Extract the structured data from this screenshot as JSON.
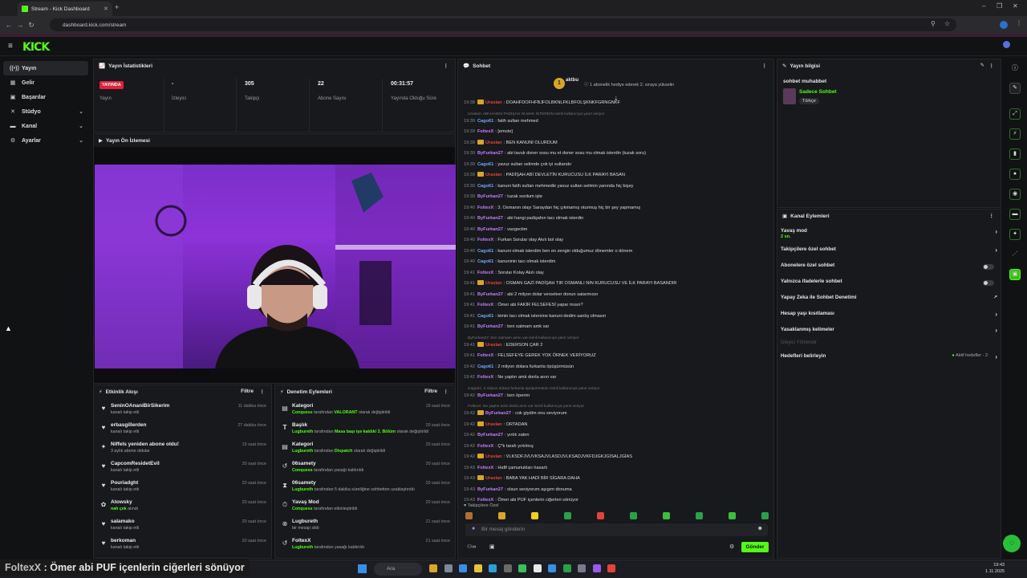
{
  "browser": {
    "tab_title": "Stream - Kick Dashboard",
    "url": "dashboard.kick.com/stream"
  },
  "logo": "KICK",
  "sidebar": {
    "items": [
      {
        "label": "Yayın",
        "icon": "broadcast-icon"
      },
      {
        "label": "Gelir",
        "icon": "money-icon"
      },
      {
        "label": "Başarılar",
        "icon": "trophy-icon"
      },
      {
        "label": "Stüdyo",
        "icon": "studio-icon"
      },
      {
        "label": "Kanal",
        "icon": "channel-icon"
      },
      {
        "label": "Ayarlar",
        "icon": "gear-icon"
      }
    ]
  },
  "stats": {
    "title": "Yayın İstatistikleri",
    "items": [
      {
        "value": "YAYINDA",
        "label": "Yayın"
      },
      {
        "value": "-",
        "label": "İzleyici"
      },
      {
        "value": "305",
        "label": "Takipçi"
      },
      {
        "value": "22",
        "label": "Abone Sayısı"
      },
      {
        "value": "00:31:57",
        "label": "Yayında Olduğu Süre"
      }
    ]
  },
  "preview": {
    "title": "Yayın Ön İzlemesi"
  },
  "activity": {
    "title": "Etkinlik Akışı",
    "filter": "Filtre",
    "items": [
      {
        "icon": "heart-icon",
        "name": "SeninOAnaniBirSikerim",
        "sub": "kanalı takip etti",
        "time": "11 dakika önce"
      },
      {
        "icon": "heart-icon",
        "name": "erbasgillerden",
        "sub": "kanalı takip etti",
        "time": "27 dakika önce"
      },
      {
        "icon": "sparkle-icon",
        "name": "Niffels yeniden abone oldu!",
        "sub": "3 aylık abone oldular",
        "time": "19 saat önce"
      },
      {
        "icon": "heart-icon",
        "name": "CapcomResidetEvil",
        "sub": "kanalı takip etti",
        "time": "20 saat önce"
      },
      {
        "icon": "heart-icon",
        "name": "Pouriadght",
        "sub": "kanalı takip etti",
        "time": "20 saat önce"
      },
      {
        "icon": "gift-icon",
        "name": "Atowsky",
        "sub": "nah çek",
        "sub_suffix": "alındı",
        "time": "20 saat önce"
      },
      {
        "icon": "heart-icon",
        "name": "salamako",
        "sub": "kanalı takip etti",
        "time": "20 saat önce"
      },
      {
        "icon": "heart-icon",
        "name": "berkoman",
        "sub": "kanalı takip etti",
        "time": "20 saat önce"
      }
    ]
  },
  "moderation": {
    "title": "Denetim Eylemleri",
    "filter": "Filtre",
    "items": [
      {
        "icon": "category-icon",
        "name": "Kategori",
        "who": "Conquess",
        "mid": " tarafından ",
        "val": "VALORANT",
        "tail": " olarak değiştirildi",
        "time": "19 saat önce"
      },
      {
        "icon": "title-icon",
        "name": "Başlık",
        "who": "Lugbureth",
        "mid": " tarafından ",
        "val": "Masa başı işe kaldık/ 2. Bölüm",
        "tail": " olarak değiştirildi",
        "time": "20 saat önce"
      },
      {
        "icon": "category-icon",
        "name": "Kategori",
        "who": "Lugbureth",
        "mid": " tarafından ",
        "val": "Dispatch",
        "tail": " olarak değiştirildi",
        "time": "20 saat önce"
      },
      {
        "icon": "undo-icon",
        "name": "06samety",
        "who": "Conquess",
        "mid": " tarafından yasağı kaldırıldı",
        "val": "",
        "tail": "",
        "time": "20 saat önce"
      },
      {
        "icon": "hourglass-icon",
        "name": "06samety",
        "who": "Lugbureth",
        "mid": " tarafından 5 dakika süreliğine sohbetten uzaklaştırıldı",
        "val": "",
        "tail": "",
        "time": "20 saat önce"
      },
      {
        "icon": "slow-icon",
        "name": "Yavaş Mod",
        "who": "Conquess",
        "mid": " tarafından etkinleştirildi",
        "val": "",
        "tail": "",
        "time": "20 saat önce"
      },
      {
        "icon": "delete-icon",
        "name": "Lugbureth",
        "who": "",
        "mid": "bir mesajı sildi",
        "val": "",
        "tail": "",
        "time": "21 saat önce"
      },
      {
        "icon": "undo-icon",
        "name": "FoltexX",
        "who": "Lugbureth",
        "mid": " tarafından yasağı kaldırıldı",
        "val": "",
        "tail": "",
        "time": "21 saat önce"
      }
    ]
  },
  "chat": {
    "title": "Sohbet",
    "pinned_user": "aktbu",
    "pinned_count": "1",
    "pinned_text": "1 abonelik hediye ederek 2. sıraya yükselin",
    "messages": [
      {
        "type": "msg",
        "time": "19:38",
        "user": "Uraslan",
        "color": "#e0443a",
        "tier": true,
        "text": ": DOAHFDOFHFBJFOLBKNLFKLBFOLŞKNKFGRNGNKF"
      },
      {
        "type": "reply",
        "text": "Uraslan: ABİ HANGİ PADİŞAH OLMAK İSTERDİN isimli kullanıcıya yanıt veriyor"
      },
      {
        "type": "msg",
        "time": "19:39",
        "user": "Cago61",
        "color": "#6fa8ff",
        "tier": false,
        "text": ": fatih sultan mehmed"
      },
      {
        "type": "msg",
        "time": "19:39",
        "user": "FoltexX",
        "color": "#c77dff",
        "tier": false,
        "text": ": [emote]"
      },
      {
        "type": "msg",
        "time": "19:39",
        "user": "Uraslan",
        "color": "#e0443a",
        "tier": true,
        "text": ": BEN KANUNİ OLURDUM"
      },
      {
        "type": "msg",
        "time": "19:39",
        "user": "ByFurkan27",
        "color": "#c77dff",
        "tier": false,
        "text": ": abi tavuk doner sosu mu et doner sosu mu olmak isterdin (tuzak soru)"
      },
      {
        "type": "msg",
        "time": "19:39",
        "user": "Cago61",
        "color": "#6fa8ff",
        "tier": false,
        "text": ": yavuz sultan selimde çok iyi sultandır"
      },
      {
        "type": "msg",
        "time": "19:39",
        "user": "Uraslan",
        "color": "#e0443a",
        "tier": true,
        "text": ": PADİŞAH ABİ DEVLETİN KURUCUSU İLK PARAYI BASAN"
      },
      {
        "type": "msg",
        "time": "19:39",
        "user": "Cago61",
        "color": "#6fa8ff",
        "tier": false,
        "text": ": kanuni fatih sultan mehmedle yavuz sultan selimin yanında hiç bişey"
      },
      {
        "type": "msg",
        "time": "19:39",
        "user": "ByFurkan27",
        "color": "#c77dff",
        "tier": false,
        "text": ": tuzak sordum işte"
      },
      {
        "type": "msg",
        "time": "19:40",
        "user": "FoltexX",
        "color": "#c77dff",
        "tier": false,
        "text": ": 3. Osmanın olayı Saraydan hiç çıkmamış oturmuş hiç bir şey yapmamış"
      },
      {
        "type": "msg",
        "time": "19:40",
        "user": "ByFurkan27",
        "color": "#c77dff",
        "tier": false,
        "text": ": abi hangi padişahın tacı olmak isterdin"
      },
      {
        "type": "msg",
        "time": "19:40",
        "user": "ByFurkan27",
        "color": "#c77dff",
        "tier": false,
        "text": ": vazgectim"
      },
      {
        "type": "msg",
        "time": "19:40",
        "user": "FoltexX",
        "color": "#c77dff",
        "tier": false,
        "text": ": Furkan Sorular olay Akılı bol olay"
      },
      {
        "type": "msg",
        "time": "19:40",
        "user": "Cago61",
        "color": "#6fa8ff",
        "tier": false,
        "text": ": kanuni olmak isterdim ben en zengin olduğumuz dönemler o dönem"
      },
      {
        "type": "msg",
        "time": "19:40",
        "user": "Cago61",
        "color": "#6fa8ff",
        "tier": false,
        "text": ": kanuninin tacı olmak isterdim"
      },
      {
        "type": "msg",
        "time": "19:41",
        "user": "FoltexX",
        "color": "#c77dff",
        "tier": false,
        "text": ": Sorular Kolay Akılı olay"
      },
      {
        "type": "msg",
        "time": "19:41",
        "user": "Uraslan",
        "color": "#e0443a",
        "tier": true,
        "text": ": OSMAN GAZİ PADİŞAH TIR OSMANLI NIN KURUCUSU VE İLK PARAYI BASANDIR"
      },
      {
        "type": "msg",
        "time": "19:41",
        "user": "ByFurkan27",
        "color": "#c77dff",
        "tier": false,
        "text": ": abi 2 milyon dolar verseleer donun satarmısın"
      },
      {
        "type": "msg",
        "time": "19:41",
        "user": "FoltexX",
        "color": "#c77dff",
        "tier": false,
        "text": ": Ömer abi FAKİR FELSEFESİ yapar mısın?"
      },
      {
        "type": "msg",
        "time": "19:41",
        "user": "Cago61",
        "color": "#6fa8ff",
        "tier": false,
        "text": ": kimin tacı olmak istersine kanuni dedim uanlış olmasın"
      },
      {
        "type": "msg",
        "time": "19:41",
        "user": "ByFurkan27",
        "color": "#c77dff",
        "tier": false,
        "text": ": ben satmam amk var"
      },
      {
        "type": "reply",
        "text": "ByFurkan27: ben satmam amın var isimli kullanıcıya yanıt veriyor"
      },
      {
        "type": "msg",
        "time": "19:41",
        "user": "Uraslan",
        "color": "#e0443a",
        "tier": true,
        "text": ": EDERSON ÇAR 2"
      },
      {
        "type": "msg",
        "time": "19:41",
        "user": "FoltexX",
        "color": "#c77dff",
        "tier": false,
        "text": ": FELSEFEYE GEREK YOK ÖRNEK VERİYORUZ"
      },
      {
        "type": "msg",
        "time": "19:42",
        "user": "Cago61",
        "color": "#6fa8ff",
        "tier": false,
        "text": ": 2 milyon dolara furkanla öpüşürmüsün"
      },
      {
        "type": "msg",
        "time": "19:42",
        "user": "FoltexX",
        "color": "#c77dff",
        "tier": false,
        "text": ": Ne yaptın amk donla anın var"
      },
      {
        "type": "reply",
        "text": "Cago61: 2 milyon dolara furkanla öpüşürmüsün isimli kullanıcıya yanıt veriyor"
      },
      {
        "type": "msg",
        "time": "19:42",
        "user": "ByFurkan27",
        "color": "#c77dff",
        "tier": false,
        "text": ": ben öperim"
      },
      {
        "type": "reply",
        "text": "FoltexX: Ne yaptın amk donla anın var isimli kullanıcıya yanıt veriyor"
      },
      {
        "type": "msg",
        "time": "19:42",
        "user": "ByFurkan27",
        "color": "#c77dff",
        "tier": true,
        "text": ": cok giydim onu seviyorum"
      },
      {
        "type": "msg",
        "time": "19:42",
        "user": "Uraslan",
        "color": "#e0443a",
        "tier": true,
        "text": ": ORTADAN"
      },
      {
        "type": "msg",
        "time": "19:42",
        "user": "ByFurkan27",
        "color": "#c77dff",
        "tier": false,
        "text": ": yırtık zaten"
      },
      {
        "type": "msg",
        "time": "19:42",
        "user": "FoltexX",
        "color": "#c77dff",
        "tier": false,
        "text": ": Ç*k tarafı yırtılmış"
      },
      {
        "type": "msg",
        "time": "19:42",
        "user": "Uraslan",
        "color": "#e0443a",
        "tier": true,
        "text": ": VLKSDFJVUVKSAJVLASDJVLKSADJVKFDJGKJGİSALJGİAS"
      },
      {
        "type": "msg",
        "time": "19:43",
        "user": "FoltexX",
        "color": "#c77dff",
        "tier": false,
        "text": ": Hafif çamuriukları hasarlı"
      },
      {
        "type": "msg",
        "time": "19:43",
        "user": "Uraslan",
        "color": "#e0443a",
        "tier": true,
        "text": ": BABA YAK HADİ BİR SİGARA DAHA"
      },
      {
        "type": "msg",
        "time": "19:43",
        "user": "ByFurkan27",
        "color": "#c77dff",
        "tier": false,
        "text": ": olsun seviyorum aşıgım donuma"
      },
      {
        "type": "msg",
        "time": "19:43",
        "user": "FoltexX",
        "color": "#c77dff",
        "tier": false,
        "text": ": Ömer abi PUF içenlerin ciğerleri sönüyor"
      }
    ],
    "followers_only": "Takipçilere Özel",
    "input_placeholder": "Bir mesaj gönderin",
    "send_label": "Gönder"
  },
  "stream_info": {
    "title": "Yayın bilgisi",
    "stream_title": "sohbet muhabbet",
    "category": "Sadece Sohbet",
    "language": "Türkçe"
  },
  "channel_actions": {
    "title": "Kanal Eylemleri",
    "slow_mode": "Yavaş mod",
    "slow_value": "2 sn.",
    "items": [
      {
        "label": "Takipçilere özel sohbet",
        "control": "chevron"
      },
      {
        "label": "Abonelere özel sohbet",
        "control": "toggle"
      },
      {
        "label": "Yalnızca ifadelerle sohbet",
        "control": "toggle"
      },
      {
        "label": "Yapay Zeka ile Sohbet Denetimi",
        "control": "external"
      },
      {
        "label": "Hesap yaşı kısıtlaması",
        "control": "chevron"
      },
      {
        "label": "Yasaklanmış kelimeler",
        "control": "chevron"
      }
    ],
    "viewer_director": "İzleyici Yönlendir",
    "goals_label": "Hedefleri belirleyin",
    "goals_status": "Aktif hedefler - 2"
  },
  "overlay": {
    "user": "FoltexX",
    "message": " : Ömer abi PUF içenlerin ciğerleri sönüyor"
  },
  "taskbar": {
    "search": "Ara",
    "time": "19:43",
    "date": "1.11.2025"
  }
}
